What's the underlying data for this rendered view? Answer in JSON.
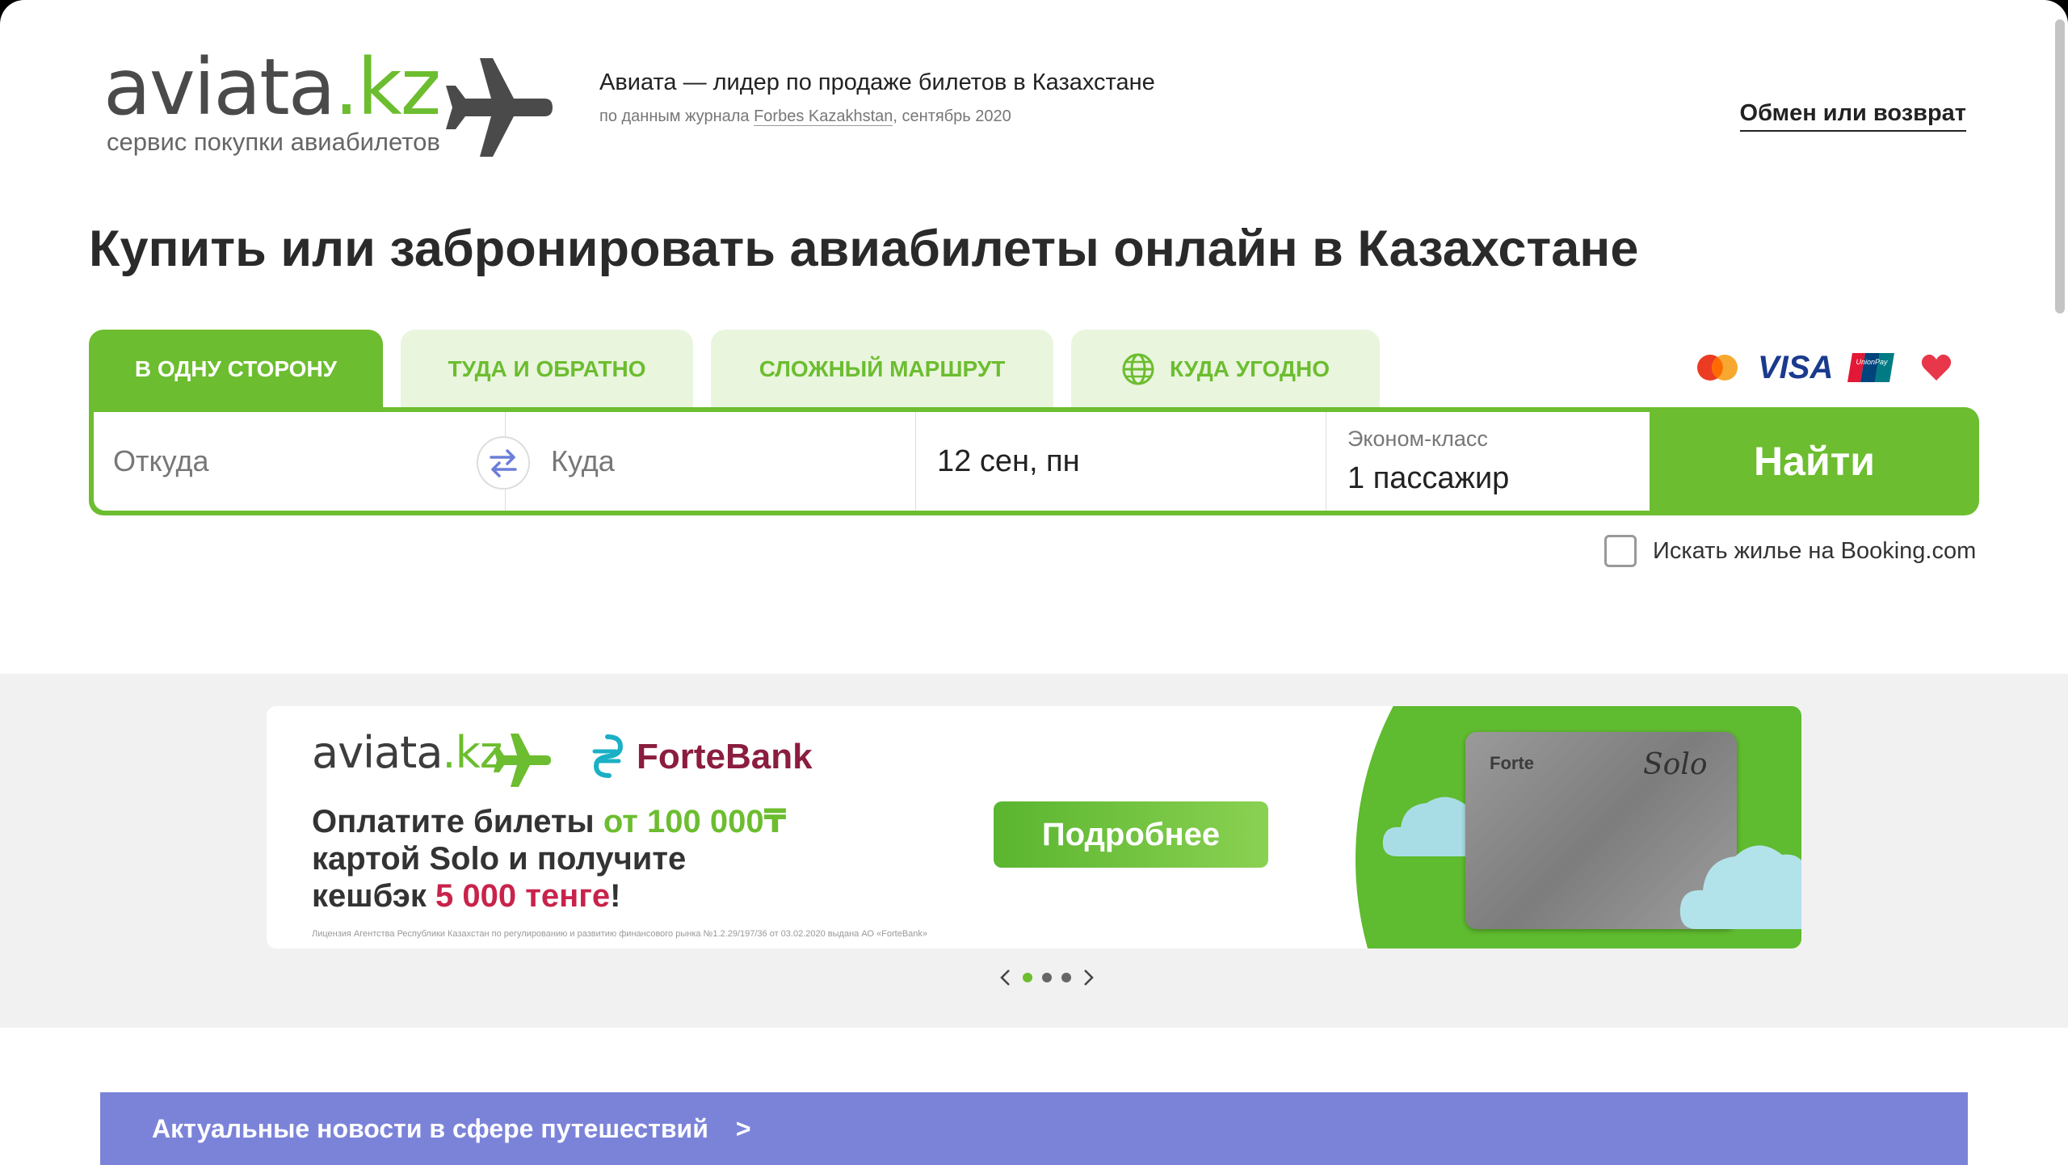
{
  "header": {
    "logo_word_gray": "aviata",
    "logo_word_green": ".kz",
    "logo_subtitle": "сервис покупки авиабилетов",
    "tagline_main": "Авиата — лидер по продаже билетов в Казахстане",
    "tagline_sub_prefix": "по данным журнала ",
    "tagline_sub_link": "Forbes Kazakhstan",
    "tagline_sub_suffix": ", сентябрь 2020",
    "exchange_link": "Обмен или возврат"
  },
  "page_title": "Купить или забронировать авиабилеты онлайн в Казахстане",
  "tabs": [
    {
      "label": "В одну сторону",
      "active": true
    },
    {
      "label": "Туда и обратно",
      "active": false
    },
    {
      "label": "Сложный маршрут",
      "active": false
    },
    {
      "label": "Куда угодно",
      "active": false,
      "icon": "globe-icon"
    }
  ],
  "payment_icons": [
    "mastercard-icon",
    "visa-icon",
    "unionpay-icon",
    "heart-icon"
  ],
  "payment_text": {
    "visa": "VISA",
    "unionpay": "UnionPay"
  },
  "search": {
    "from_placeholder": "Откуда",
    "to_placeholder": "Куда",
    "date_value": "12 сен, пн",
    "class_label": "Эконом-класс",
    "passengers_value": "1 пассажир",
    "find_button": "Найти",
    "booking_checkbox_label": "Искать жилье на Booking.com",
    "booking_checked": false
  },
  "banner": {
    "logo_gray": "aviata",
    "logo_green": ".kz",
    "partner": "ForteBank",
    "promo_line1_a": "Оплатите билеты ",
    "promo_line1_b": "от 100 000₸",
    "promo_line2": "картой Solo и получите",
    "promo_line3_a": "кешбэк ",
    "promo_line3_b": "5 000 тенге",
    "promo_line3_c": "!",
    "button": "Подробнее",
    "license": "Лицензия Агентства Республики Казахстан по регулированию и развитию финансового рынка №1.2.29/197/36 от 03.02.2020 выдана АО «ForteBank»",
    "card_brand": "Forte",
    "card_solo": "Solo",
    "slides_total": 3,
    "active_slide": 0
  },
  "news": {
    "label": "Актуальные новости в сфере путешествий",
    "arrow": ">"
  },
  "colors": {
    "brand_green": "#6cbd2f",
    "light_green": "#e9f5dd",
    "news_purple": "#7b83d9",
    "forte_red": "#8b1d3f"
  }
}
